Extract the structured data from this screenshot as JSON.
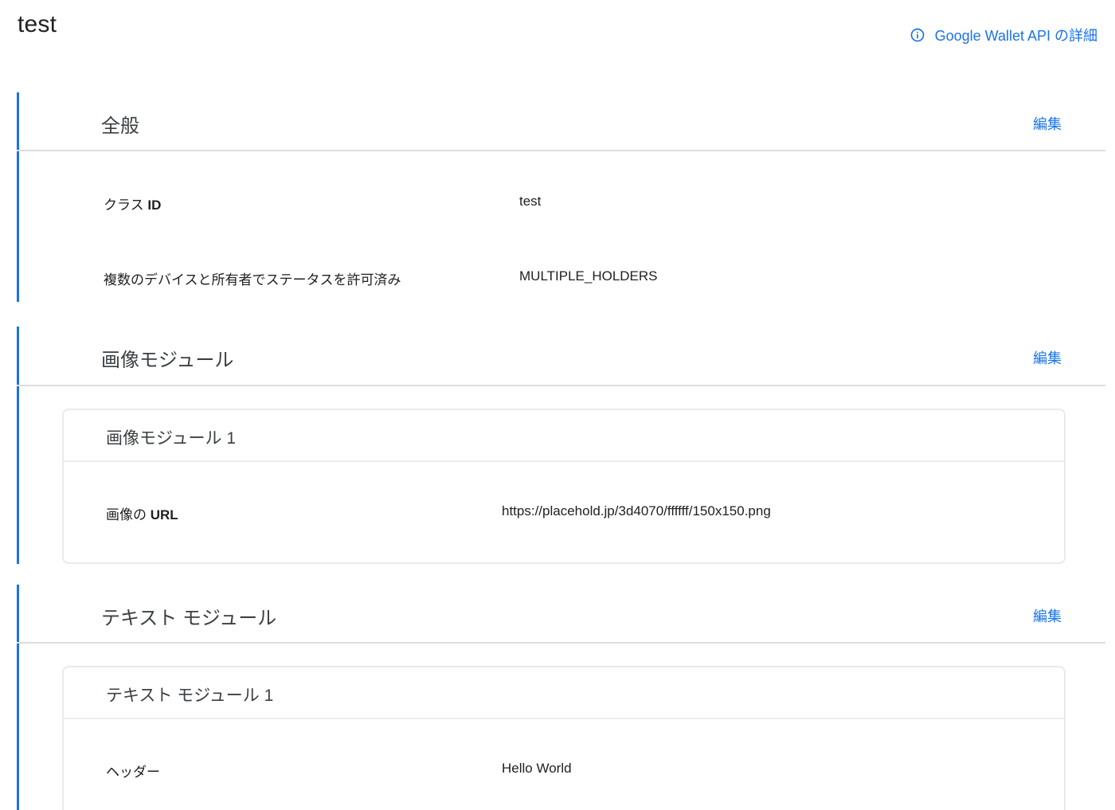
{
  "page": {
    "title": "test",
    "help_link": "Google Wallet API の詳細"
  },
  "sections": {
    "general": {
      "title": "全般",
      "edit": "編集",
      "rows": [
        {
          "label": "クラス ",
          "label_bold": "ID",
          "value": "test"
        },
        {
          "label": "複数のデバイスと所有者でステータスを許可済み",
          "label_bold": "",
          "value": "MULTIPLE_HOLDERS"
        }
      ]
    },
    "image_module": {
      "title": "画像モジュール",
      "edit": "編集",
      "card": {
        "title": "画像モジュール 1",
        "label": "画像の ",
        "label_bold": "URL",
        "value": "https://placehold.jp/3d4070/ffffff/150x150.png"
      }
    },
    "text_module": {
      "title": "テキスト モジュール",
      "edit": "編集",
      "card": {
        "title": "テキスト モジュール 1",
        "label": "ヘッダー",
        "value": "Hello World"
      }
    }
  },
  "colors": {
    "accent": "#1a73e8",
    "divider": "#dadce0"
  },
  "icons": {
    "help": "info-icon"
  }
}
